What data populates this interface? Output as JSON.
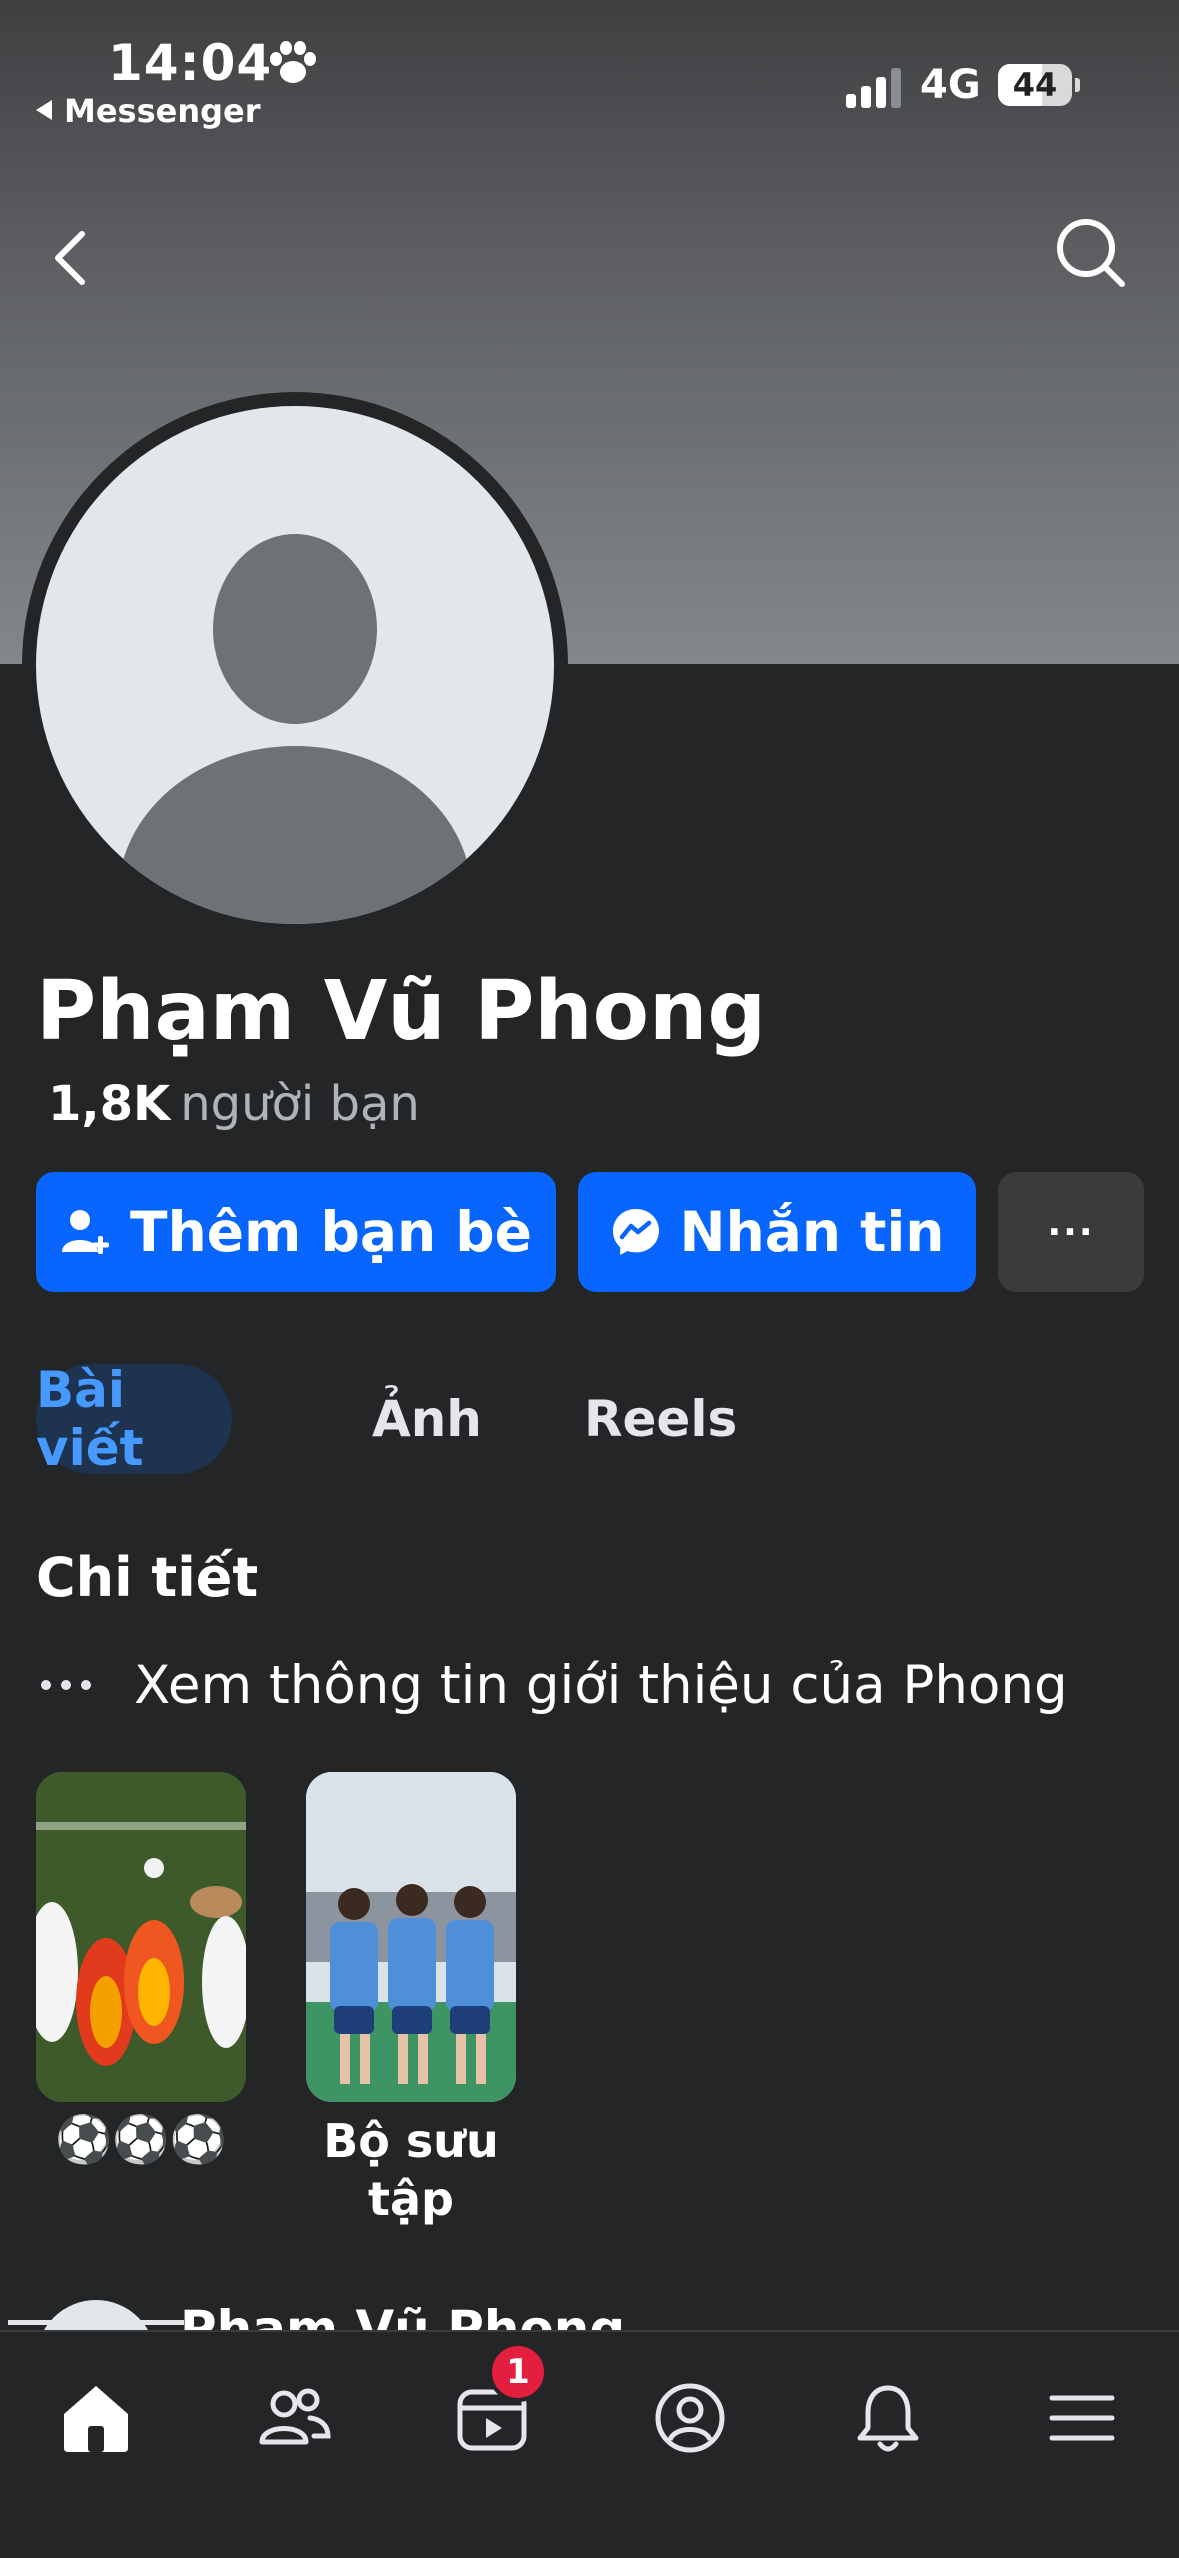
{
  "status_bar": {
    "time": "14:04",
    "back_app": "Messenger",
    "network": "4G",
    "battery": "44"
  },
  "profile": {
    "name": "Phạm Vũ Phong",
    "friends_count": "1,8K",
    "friends_label": "người bạn"
  },
  "actions": {
    "add_friend": "Thêm bạn bè",
    "message": "Nhắn tin",
    "more": "···"
  },
  "tabs": [
    {
      "label": "Bài viết",
      "active": true
    },
    {
      "label": "Ảnh",
      "active": false
    },
    {
      "label": "Reels",
      "active": false
    }
  ],
  "details": {
    "title": "Chi tiết",
    "intro_link": "Xem thông tin giới thiệu của Phong"
  },
  "highlights": [
    {
      "caption": "⚽⚽⚽"
    },
    {
      "caption": "Bộ sưu tập"
    }
  ],
  "post_preview": {
    "author": "Phạm Vũ Phong"
  },
  "tab_bar": {
    "items": [
      "home-icon",
      "friends-icon",
      "video-icon",
      "profile-icon",
      "bell-icon",
      "menu-icon"
    ],
    "video_badge": "1"
  },
  "colors": {
    "accent": "#0866ff",
    "background": "#232526",
    "badge": "#e41e3f"
  }
}
